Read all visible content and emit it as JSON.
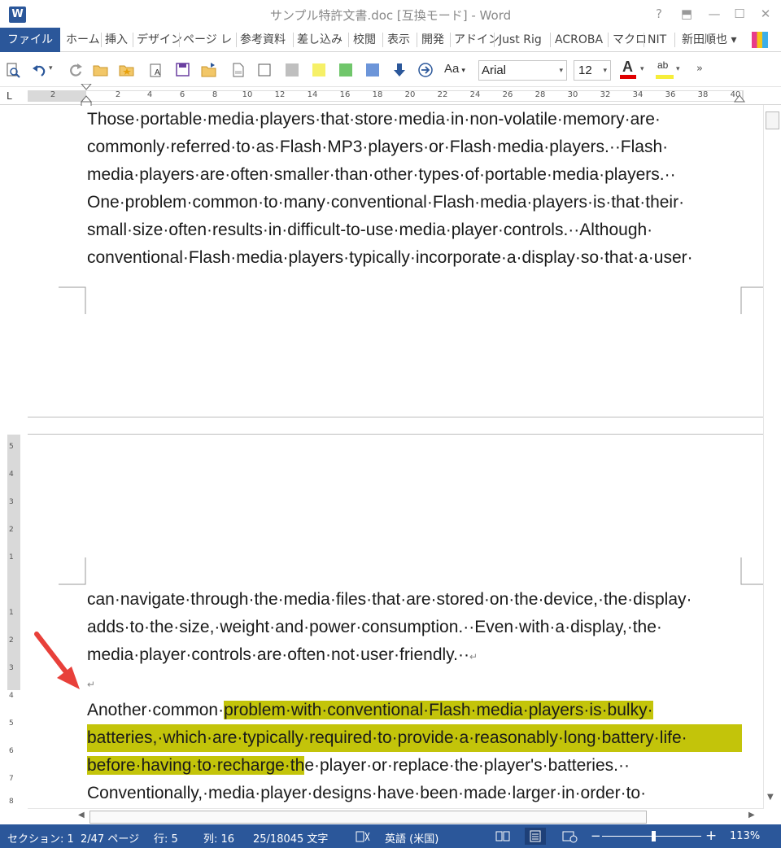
{
  "app": {
    "title": "サンプル特許文書.doc [互換モード] - Word",
    "icon_letter": "W",
    "window_controls": [
      "?",
      "⬒",
      "—",
      "☐",
      "✕"
    ]
  },
  "ribbon": {
    "file_tab": "ファイル",
    "tabs": [
      "ホーム",
      "挿入",
      "デザイン",
      "ページ レ",
      "参考資料",
      "差し込み",
      "校閲",
      "表示",
      "開発",
      "アドイン",
      "Just Rig",
      "ACROBA",
      "マクロ",
      "NIT",
      "新田順也 ▾"
    ]
  },
  "toolbar": {
    "font_name": "Arial",
    "font_size": "12",
    "font_color_label": "A",
    "highlight_label": "ab",
    "aa_label": "Aa",
    "more": "»",
    "colors": {
      "font_color": "#e00000",
      "highlight": "#f6ee3a",
      "swatch_gray": "#bfbfbf",
      "swatch_yellow": "#f6f067",
      "swatch_green": "#70c66b",
      "swatch_blue": "#6c95d9"
    }
  },
  "ruler": {
    "tab_selector": "L",
    "numbers": [
      "2",
      "2",
      "4",
      "6",
      "8",
      "10",
      "12",
      "14",
      "16",
      "18",
      "20",
      "22",
      "24",
      "26",
      "28",
      "30",
      "32",
      "34",
      "36",
      "38",
      "40"
    ]
  },
  "vertical_ruler": {
    "upper_numbers": [
      "5",
      "4",
      "3",
      "2",
      "1"
    ],
    "lower_numbers": [
      "1",
      "2",
      "3",
      "4",
      "5",
      "6",
      "7",
      "8"
    ]
  },
  "document": {
    "page1_lines": [
      "Those·portable·media·players·that·store·media·in·non-volatile·memory·are·",
      "commonly·referred·to·as·Flash·MP3·players·or·Flash·media·players.··Flash·",
      "media·players·are·often·smaller·than·other·types·of·portable·media·players.··",
      "One·problem·common·to·many·conventional·Flash·media·players·is·that·their·",
      "small·size·often·results·in·difficult-to-use·media·player·controls.··Although·",
      "conventional·Flash·media·players·typically·incorporate·a·display·so·that·a·user·"
    ],
    "page2_lines": [
      "can·navigate·through·the·media·files·that·are·stored·on·the·device,·the·display·",
      "adds·to·the·size,·weight·and·power·consumption.··Even·with·a·display,·the·",
      "media·player·controls·are·often·not·user·friendly.··"
    ],
    "paragraph_mark": "↵",
    "p2_line1_pre": "Another·common·",
    "p2_line1_hl": "problem·with·conventional·Flash·media·players·is·bulky·",
    "p2_line2_hl": "batteries,·which·are·typically·required·to·provide·a·reasonably·long·battery·life·",
    "p2_line3_hl": "before·having·to·recharge·th",
    "p2_line3_post": "e·player·or·replace·the·player's·batteries.··",
    "p2_line4": "Conventionally,·media·player·designs·have·been·made·larger·in·order·to·",
    "highlight_color": "#c3c40a",
    "annotation_color": "#e8403a"
  },
  "status_bar": {
    "section": "セクション: 1",
    "page": "2/47 ページ",
    "line": "行: 5",
    "column": "列: 16",
    "words": "25/18045 文字",
    "language": "英語 (米国)",
    "zoom_minus": "−",
    "zoom_plus": "+",
    "zoom": "113%"
  }
}
